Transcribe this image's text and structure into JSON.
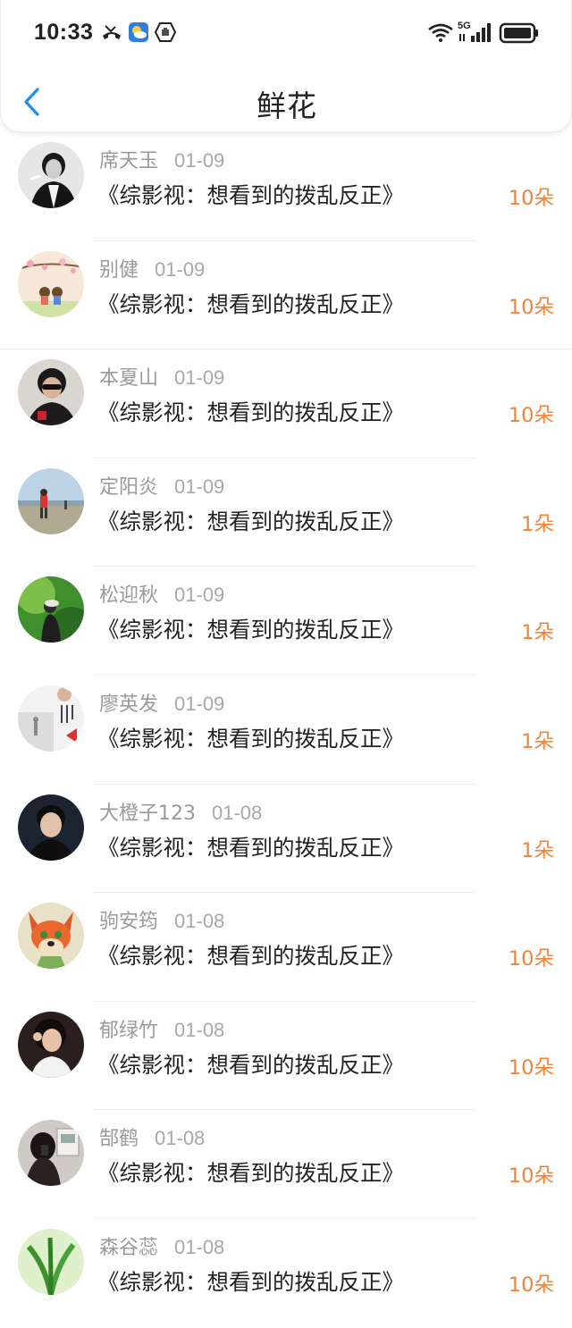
{
  "status": {
    "time": "10:33",
    "network": "5G"
  },
  "header": {
    "title": "鲜花"
  },
  "colors": {
    "accent": "#1e8ff0",
    "count": "#f0843a"
  },
  "items": [
    {
      "name": "席天玉",
      "date": "01-09",
      "book": "《综影视：想看到的拨乱反正》",
      "count": "10朵"
    },
    {
      "name": "别健",
      "date": "01-09",
      "book": "《综影视：想看到的拨乱反正》",
      "count": "10朵"
    },
    {
      "name": "本夏山",
      "date": "01-09",
      "book": "《综影视：想看到的拨乱反正》",
      "count": "10朵"
    },
    {
      "name": "定阳炎",
      "date": "01-09",
      "book": "《综影视：想看到的拨乱反正》",
      "count": "1朵"
    },
    {
      "name": "松迎秋",
      "date": "01-09",
      "book": "《综影视：想看到的拨乱反正》",
      "count": "1朵"
    },
    {
      "name": "廖英发",
      "date": "01-09",
      "book": "《综影视：想看到的拨乱反正》",
      "count": "1朵"
    },
    {
      "name": "大橙子123",
      "date": "01-08",
      "book": "《综影视：想看到的拨乱反正》",
      "count": "1朵"
    },
    {
      "name": "驹安筠",
      "date": "01-08",
      "book": "《综影视：想看到的拨乱反正》",
      "count": "10朵"
    },
    {
      "name": "郁绿竹",
      "date": "01-08",
      "book": "《综影视：想看到的拨乱反正》",
      "count": "10朵"
    },
    {
      "name": "郜鹤",
      "date": "01-08",
      "book": "《综影视：想看到的拨乱反正》",
      "count": "10朵"
    },
    {
      "name": "森谷蕊",
      "date": "01-08",
      "book": "《综影视：想看到的拨乱反正》",
      "count": "10朵"
    }
  ]
}
